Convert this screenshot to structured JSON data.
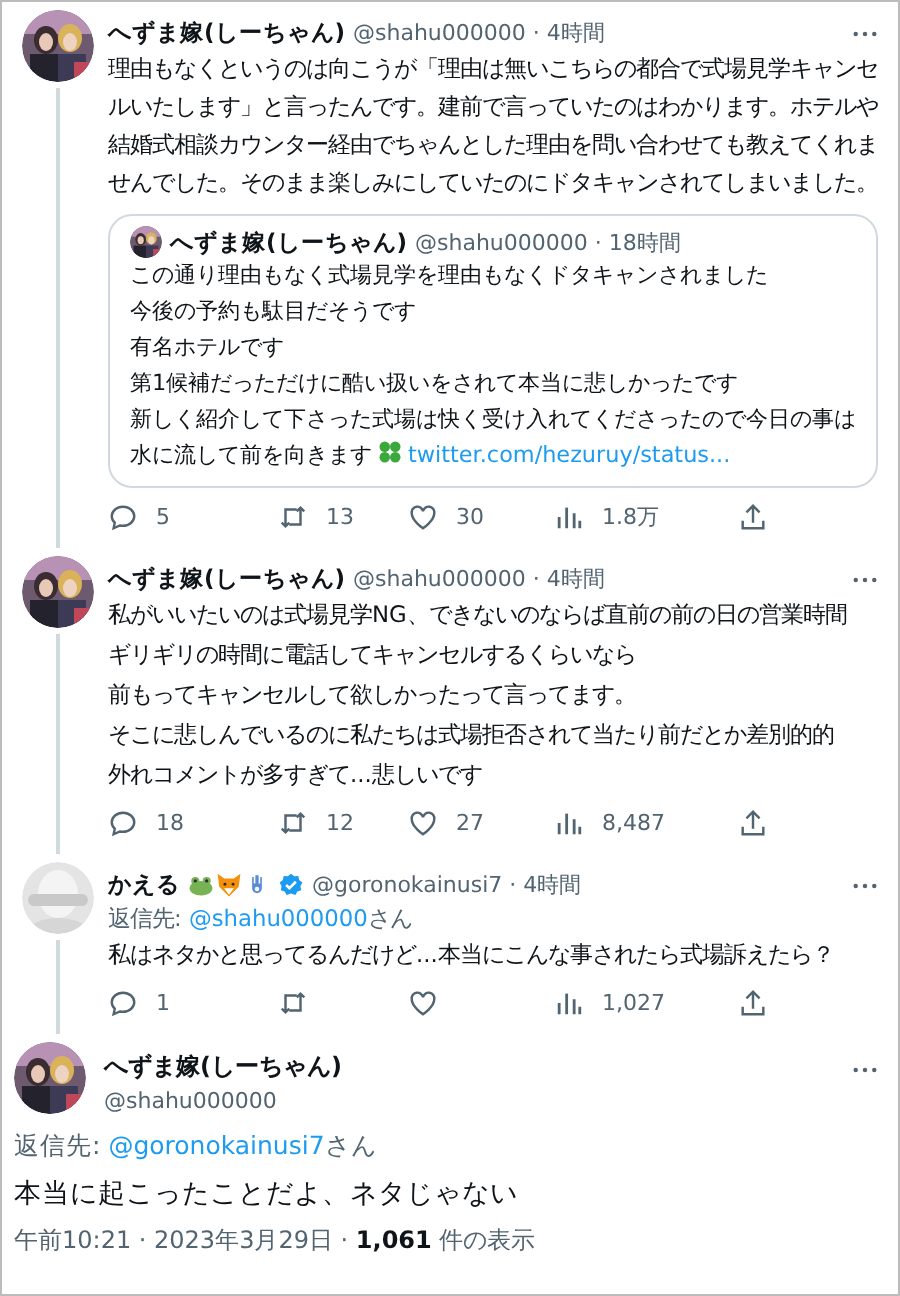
{
  "thread": [
    {
      "name": "へずま嫁(しーちゃん)",
      "meta": "@shahu000000 · 4時間",
      "text": "理由もなくというのは向こうが「理由は無いこちらの都合で式場見学キャンセルいたします」と言ったんです。建前で言っていたのはわかります。ホテルや結婚式相談カウンター経由でちゃんとした理由を問い合わせても教えてくれませんでした。そのまま楽しみにしていたのにドタキャンされてしまいました。",
      "quote": {
        "name": "へずま嫁(しーちゃん)",
        "meta": "@shahu000000 · 18時間",
        "lines": [
          "この通り理由もなく式場見学を理由もなくドタキャンされました",
          "今後の予約も駄目だそうです",
          "有名ホテルです",
          "第1候補だっただけに酷い扱いをされて本当に悲しかったです",
          "新しく紹介して下さった式場は快く受け入れてくださったので今日の事は水に流して前を向きます"
        ],
        "link": "twitter.com/hezuruy/status..."
      },
      "actions": [
        {
          "kind": "reply",
          "count": "5"
        },
        {
          "kind": "retweet",
          "count": "13"
        },
        {
          "kind": "like",
          "count": "30"
        },
        {
          "kind": "views",
          "count": "1.8万"
        },
        {
          "kind": "share"
        }
      ]
    },
    {
      "name": "へずま嫁(しーちゃん)",
      "meta": "@shahu000000 · 4時間",
      "lines": [
        "私がいいたいのは式場見学NG、できないのならば直前の前の日の営業時間",
        "ギリギリの時間に電話してキャンセルするくらいなら",
        "前もってキャンセルして欲しかったって言ってます。",
        "そこに悲しんでいるのに私たちは式場拒否されて当たり前だとか差別的的",
        "外れコメントが多すぎて...悲しいです"
      ],
      "actions": [
        {
          "kind": "reply",
          "count": "18"
        },
        {
          "kind": "retweet",
          "count": "12"
        },
        {
          "kind": "like",
          "count": "27"
        },
        {
          "kind": "views",
          "count": "8,487"
        },
        {
          "kind": "share"
        }
      ]
    },
    {
      "name": "かえる",
      "name_icons": [
        {
          "kind": "frog"
        },
        {
          "kind": "fox"
        },
        {
          "kind": "hamsa"
        }
      ],
      "verified": true,
      "meta": "@goronokainusi7 · 4時間",
      "reply_label": "返信先: ",
      "reply_to": "@shahu000000",
      "reply_suffix": "さん",
      "text": "私はネタかと思ってるんだけど...本当にこんな事されたら式場訴えたら？",
      "actions": [
        {
          "kind": "reply",
          "count": "1"
        },
        {
          "kind": "retweet"
        },
        {
          "kind": "like"
        },
        {
          "kind": "views",
          "count": "1,027"
        },
        {
          "kind": "share"
        }
      ]
    }
  ],
  "main": {
    "name": "へずま嫁(しーちゃん)",
    "handle": "@shahu000000",
    "reply_label": "返信先: ",
    "reply_to": "@goronokainusi7",
    "reply_suffix": "さん",
    "text": "本当に起こったことだよ、ネタじゃない",
    "timestamp": "午前10:21 · 2023年3月29日 · ",
    "views": "1,061",
    "views_label": " 件の表示"
  }
}
